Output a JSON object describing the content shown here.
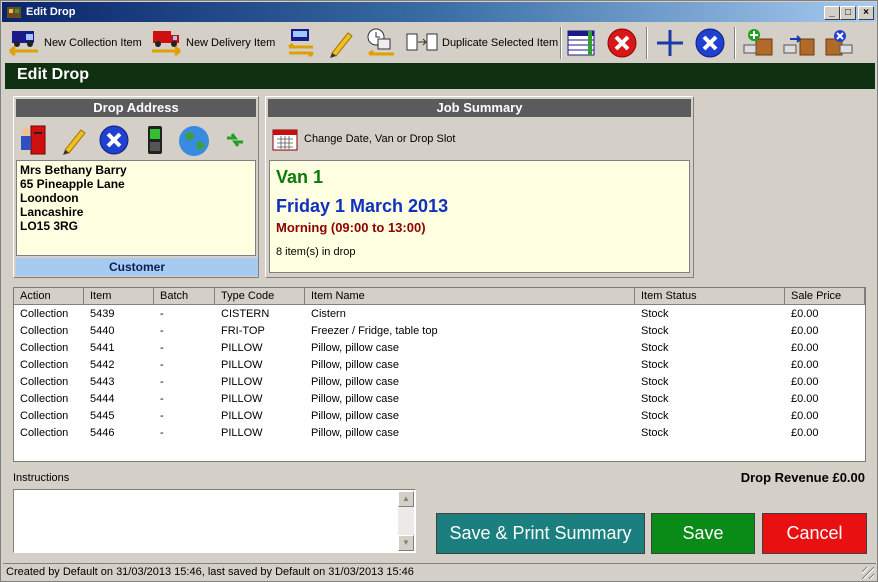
{
  "window": {
    "title": "Edit Drop"
  },
  "toolbar": {
    "new_collection": "New Collection Item",
    "new_delivery": "New Delivery Item",
    "duplicate": "Duplicate Selected Item"
  },
  "header": {
    "title": "Edit Drop"
  },
  "drop_address": {
    "heading": "Drop Address",
    "lines": [
      "Mrs Bethany Barry",
      "65 Pineapple Lane",
      "Loondoon",
      "Lancashire",
      "LO15 3RG"
    ],
    "footer": "Customer"
  },
  "job_summary": {
    "heading": "Job Summary",
    "change_link": "Change Date, Van or Drop Slot",
    "van": "Van 1",
    "date": "Friday 1 March 2013",
    "slot": "Morning (09:00 to 13:00)",
    "item_count": "8 item(s) in drop"
  },
  "table": {
    "columns": [
      "Action",
      "Item",
      "Batch",
      "Type Code",
      "Item Name",
      "Item Status",
      "Sale Price"
    ],
    "rows": [
      [
        "Collection",
        "5439",
        "-",
        "CISTERN",
        "Cistern",
        "Stock",
        "£0.00"
      ],
      [
        "Collection",
        "5440",
        "-",
        "FRI-TOP",
        "Freezer / Fridge, table top",
        "Stock",
        "£0.00"
      ],
      [
        "Collection",
        "5441",
        "-",
        "PILLOW",
        "Pillow, pillow case",
        "Stock",
        "£0.00"
      ],
      [
        "Collection",
        "5442",
        "-",
        "PILLOW",
        "Pillow, pillow case",
        "Stock",
        "£0.00"
      ],
      [
        "Collection",
        "5443",
        "-",
        "PILLOW",
        "Pillow, pillow case",
        "Stock",
        "£0.00"
      ],
      [
        "Collection",
        "5444",
        "-",
        "PILLOW",
        "Pillow, pillow case",
        "Stock",
        "£0.00"
      ],
      [
        "Collection",
        "5445",
        "-",
        "PILLOW",
        "Pillow, pillow case",
        "Stock",
        "£0.00"
      ],
      [
        "Collection",
        "5446",
        "-",
        "PILLOW",
        "Pillow, pillow case",
        "Stock",
        "£0.00"
      ]
    ]
  },
  "instructions": {
    "label": "Instructions",
    "value": ""
  },
  "revenue": "Drop Revenue £0.00",
  "buttons": {
    "save_print": "Save & Print Summary",
    "save": "Save",
    "cancel": "Cancel"
  },
  "status_bar": "Created by Default on 31/03/2013 15:46, last saved by Default on 31/03/2013 15:46",
  "colors": {
    "header": "#0e2f10",
    "save_print": "#1b7f7f",
    "save": "#0a8a16",
    "cancel": "#e81010",
    "van": "#0b7a0b",
    "date": "#1030c0",
    "slot": "#8b0000"
  }
}
